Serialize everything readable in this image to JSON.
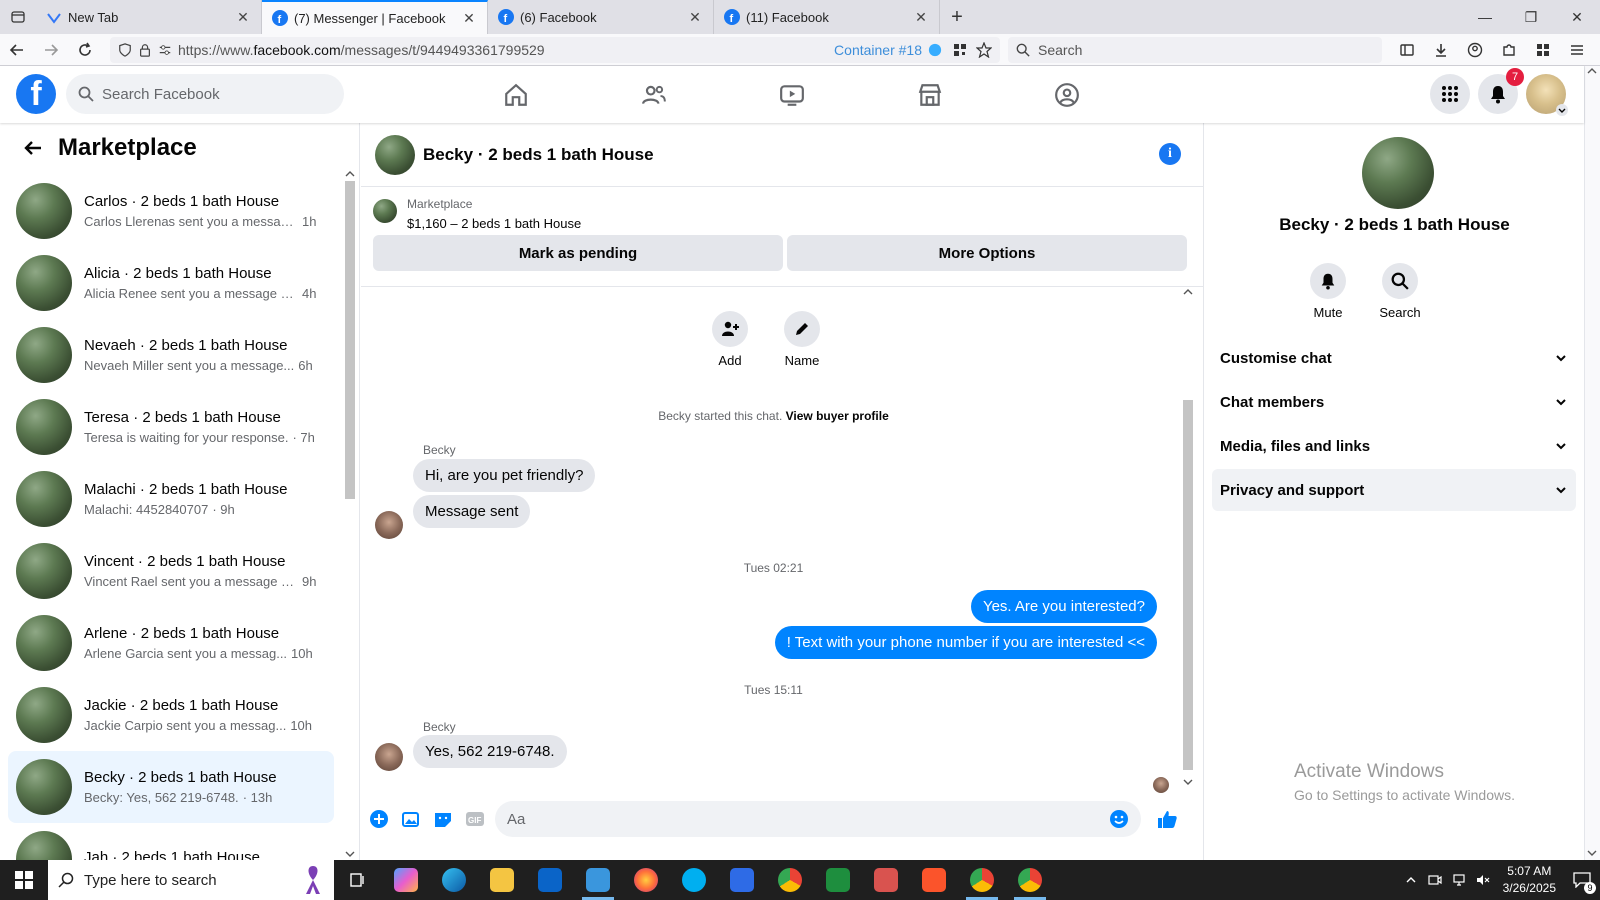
{
  "browser": {
    "tabs": [
      {
        "title": "New Tab",
        "active": false
      },
      {
        "title": "(7) Messenger | Facebook",
        "active": true
      },
      {
        "title": "(6) Facebook",
        "active": false
      },
      {
        "title": "(11) Facebook",
        "active": false
      }
    ],
    "url_prefix": "https://www.",
    "url_domain": "facebook.com",
    "url_path": "/messages/t/9449493361799529",
    "container_label": "Container #18",
    "search_placeholder": "Search"
  },
  "fb_header": {
    "logo": "f",
    "search_placeholder": "Search Facebook",
    "notification_count": "7"
  },
  "left": {
    "title": "Marketplace",
    "conversations": [
      {
        "name": "Carlos · 2 beds 1 bath House",
        "preview": "Carlos Llerenas sent you a messag...",
        "time": "1h"
      },
      {
        "name": "Alicia · 2 beds 1 bath House",
        "preview": "Alicia Renee sent you a message a...",
        "time": "4h"
      },
      {
        "name": "Nevaeh · 2 beds 1 bath House",
        "preview": "Nevaeh Miller sent you a message...",
        "time": "6h"
      },
      {
        "name": "Teresa · 2 beds 1 bath House",
        "preview": "Teresa is waiting for your response.",
        "time": "· 7h"
      },
      {
        "name": "Malachi · 2 beds 1 bath House",
        "preview": "Malachi: 4452840707",
        "time": "· 9h"
      },
      {
        "name": "Vincent · 2 beds 1 bath House",
        "preview": "Vincent Rael sent you a message a...",
        "time": "9h"
      },
      {
        "name": "Arlene · 2 beds 1 bath House",
        "preview": "Arlene Garcia sent you a messag...",
        "time": "10h"
      },
      {
        "name": "Jackie · 2 beds 1 bath House",
        "preview": "Jackie Carpio sent you a messag...",
        "time": "10h"
      },
      {
        "name": "Becky · 2 beds 1 bath House",
        "preview": "Becky: Yes, 562 219-6748.",
        "time": "· 13h"
      },
      {
        "name": "Jah · 2 beds 1 bath House",
        "preview": "",
        "time": ""
      }
    ]
  },
  "chat": {
    "title": "Becky · 2 beds 1 bath House",
    "info_icon": "i",
    "marketplace_label": "Marketplace",
    "listing": "$1,160 – 2 beds 1 bath House",
    "mark_pending": "Mark as pending",
    "more_options": "More Options",
    "add_label": "Add",
    "name_label": "Name",
    "started_text": "Becky started this chat.",
    "view_profile": "View buyer profile",
    "sender1": "Becky",
    "msg1": "Hi, are you pet friendly?",
    "msg2": "Message sent",
    "time1": "Tues 02:21",
    "out1": "Yes. Are you interested?",
    "out2": "!  Text with your phone number if you are interested <<",
    "time2": "Tues 15:11",
    "sender2": "Becky",
    "msg3": "Yes, 562 219-6748.",
    "input_placeholder": "Aa"
  },
  "right": {
    "name": "Becky · 2 beds 1 bath House",
    "mute": "Mute",
    "search": "Search",
    "sections": [
      "Customise chat",
      "Chat members",
      "Media, files and links",
      "Privacy and support"
    ],
    "activate_title": "Activate Windows",
    "activate_sub": "Go to Settings to activate Windows."
  },
  "taskbar": {
    "search_placeholder": "Type here to search",
    "time": "5:07 AM",
    "date": "3/26/2025",
    "notif_count": "9"
  },
  "colors": {
    "fb_blue": "#1877f2",
    "messenger_blue": "#0084ff",
    "selected_bg": "#ebf5ff"
  }
}
